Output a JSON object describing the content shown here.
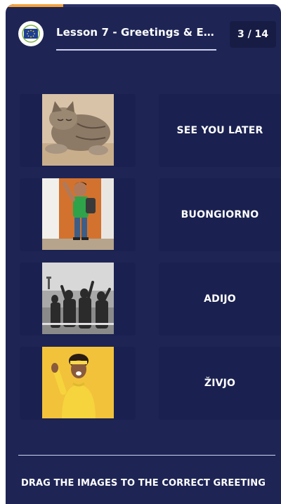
{
  "header": {
    "lesson_title": "Lesson 7 - Greetings & Ex...",
    "counter": "3 / 14",
    "progress_fraction": 0.21,
    "logo_icon": "eu-flag-icon"
  },
  "pairs": [
    {
      "image": "sleeping-cat-image",
      "word": "SEE YOU LATER"
    },
    {
      "image": "waving-boy-image",
      "word": "BUONGIORNO"
    },
    {
      "image": "people-waving-ship-image",
      "word": "ADIJO"
    },
    {
      "image": "waving-woman-image",
      "word": "ŽIVJO"
    }
  ],
  "footer": {
    "instruction": "DRAG THE IMAGES TO THE CORRECT GREETING"
  },
  "colors": {
    "background": "#1e2555",
    "slot": "#1a2150",
    "accent": "#f2a23a"
  }
}
